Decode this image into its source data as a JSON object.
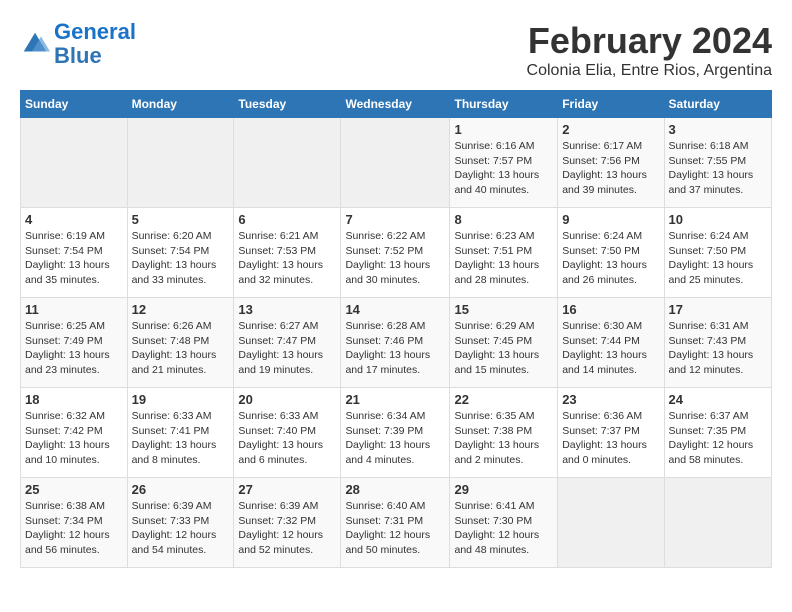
{
  "header": {
    "logo_line1": "General",
    "logo_line2": "Blue",
    "month_year": "February 2024",
    "location": "Colonia Elia, Entre Rios, Argentina"
  },
  "weekdays": [
    "Sunday",
    "Monday",
    "Tuesday",
    "Wednesday",
    "Thursday",
    "Friday",
    "Saturday"
  ],
  "weeks": [
    [
      {
        "day": "",
        "info": ""
      },
      {
        "day": "",
        "info": ""
      },
      {
        "day": "",
        "info": ""
      },
      {
        "day": "",
        "info": ""
      },
      {
        "day": "1",
        "info": "Sunrise: 6:16 AM\nSunset: 7:57 PM\nDaylight: 13 hours\nand 40 minutes."
      },
      {
        "day": "2",
        "info": "Sunrise: 6:17 AM\nSunset: 7:56 PM\nDaylight: 13 hours\nand 39 minutes."
      },
      {
        "day": "3",
        "info": "Sunrise: 6:18 AM\nSunset: 7:55 PM\nDaylight: 13 hours\nand 37 minutes."
      }
    ],
    [
      {
        "day": "4",
        "info": "Sunrise: 6:19 AM\nSunset: 7:54 PM\nDaylight: 13 hours\nand 35 minutes."
      },
      {
        "day": "5",
        "info": "Sunrise: 6:20 AM\nSunset: 7:54 PM\nDaylight: 13 hours\nand 33 minutes."
      },
      {
        "day": "6",
        "info": "Sunrise: 6:21 AM\nSunset: 7:53 PM\nDaylight: 13 hours\nand 32 minutes."
      },
      {
        "day": "7",
        "info": "Sunrise: 6:22 AM\nSunset: 7:52 PM\nDaylight: 13 hours\nand 30 minutes."
      },
      {
        "day": "8",
        "info": "Sunrise: 6:23 AM\nSunset: 7:51 PM\nDaylight: 13 hours\nand 28 minutes."
      },
      {
        "day": "9",
        "info": "Sunrise: 6:24 AM\nSunset: 7:50 PM\nDaylight: 13 hours\nand 26 minutes."
      },
      {
        "day": "10",
        "info": "Sunrise: 6:24 AM\nSunset: 7:50 PM\nDaylight: 13 hours\nand 25 minutes."
      }
    ],
    [
      {
        "day": "11",
        "info": "Sunrise: 6:25 AM\nSunset: 7:49 PM\nDaylight: 13 hours\nand 23 minutes."
      },
      {
        "day": "12",
        "info": "Sunrise: 6:26 AM\nSunset: 7:48 PM\nDaylight: 13 hours\nand 21 minutes."
      },
      {
        "day": "13",
        "info": "Sunrise: 6:27 AM\nSunset: 7:47 PM\nDaylight: 13 hours\nand 19 minutes."
      },
      {
        "day": "14",
        "info": "Sunrise: 6:28 AM\nSunset: 7:46 PM\nDaylight: 13 hours\nand 17 minutes."
      },
      {
        "day": "15",
        "info": "Sunrise: 6:29 AM\nSunset: 7:45 PM\nDaylight: 13 hours\nand 15 minutes."
      },
      {
        "day": "16",
        "info": "Sunrise: 6:30 AM\nSunset: 7:44 PM\nDaylight: 13 hours\nand 14 minutes."
      },
      {
        "day": "17",
        "info": "Sunrise: 6:31 AM\nSunset: 7:43 PM\nDaylight: 13 hours\nand 12 minutes."
      }
    ],
    [
      {
        "day": "18",
        "info": "Sunrise: 6:32 AM\nSunset: 7:42 PM\nDaylight: 13 hours\nand 10 minutes."
      },
      {
        "day": "19",
        "info": "Sunrise: 6:33 AM\nSunset: 7:41 PM\nDaylight: 13 hours\nand 8 minutes."
      },
      {
        "day": "20",
        "info": "Sunrise: 6:33 AM\nSunset: 7:40 PM\nDaylight: 13 hours\nand 6 minutes."
      },
      {
        "day": "21",
        "info": "Sunrise: 6:34 AM\nSunset: 7:39 PM\nDaylight: 13 hours\nand 4 minutes."
      },
      {
        "day": "22",
        "info": "Sunrise: 6:35 AM\nSunset: 7:38 PM\nDaylight: 13 hours\nand 2 minutes."
      },
      {
        "day": "23",
        "info": "Sunrise: 6:36 AM\nSunset: 7:37 PM\nDaylight: 13 hours\nand 0 minutes."
      },
      {
        "day": "24",
        "info": "Sunrise: 6:37 AM\nSunset: 7:35 PM\nDaylight: 12 hours\nand 58 minutes."
      }
    ],
    [
      {
        "day": "25",
        "info": "Sunrise: 6:38 AM\nSunset: 7:34 PM\nDaylight: 12 hours\nand 56 minutes."
      },
      {
        "day": "26",
        "info": "Sunrise: 6:39 AM\nSunset: 7:33 PM\nDaylight: 12 hours\nand 54 minutes."
      },
      {
        "day": "27",
        "info": "Sunrise: 6:39 AM\nSunset: 7:32 PM\nDaylight: 12 hours\nand 52 minutes."
      },
      {
        "day": "28",
        "info": "Sunrise: 6:40 AM\nSunset: 7:31 PM\nDaylight: 12 hours\nand 50 minutes."
      },
      {
        "day": "29",
        "info": "Sunrise: 6:41 AM\nSunset: 7:30 PM\nDaylight: 12 hours\nand 48 minutes."
      },
      {
        "day": "",
        "info": ""
      },
      {
        "day": "",
        "info": ""
      }
    ]
  ]
}
